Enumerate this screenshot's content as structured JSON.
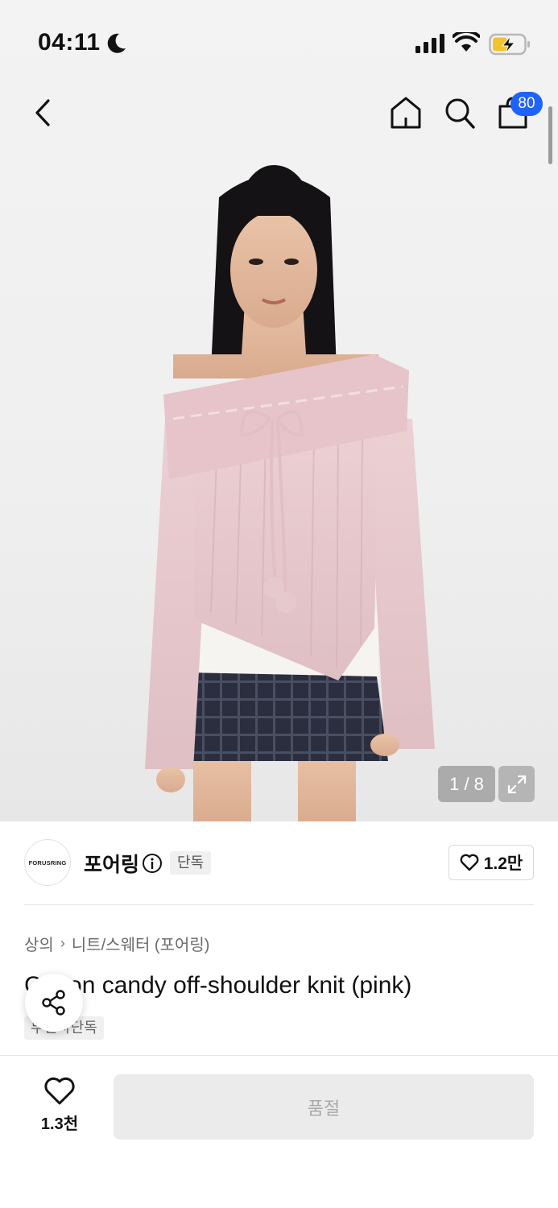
{
  "status_bar": {
    "time": "04:11",
    "icons": [
      "moon-icon",
      "signal-icon",
      "wifi-icon",
      "battery-charging-icon"
    ]
  },
  "nav": {
    "back_icon": "chevron-left-icon",
    "home_icon": "home-icon",
    "search_icon": "search-icon",
    "bag_icon": "shopping-bag-icon",
    "bag_count": "80"
  },
  "gallery": {
    "counter": "1 / 8",
    "expand_icon": "expand-icon"
  },
  "brand": {
    "logo_text": "FORUSRING",
    "name": "포어링",
    "info_icon": "info-icon",
    "tag": "단독",
    "like_count": "1.2만"
  },
  "product": {
    "breadcrumb": [
      "상의",
      "니트/스웨터 (포어링)"
    ],
    "title": "Cotton candy off-shoulder knit (pink)",
    "exclusive_tag": "무신사단독"
  },
  "bottom_bar": {
    "like_count": "1.3천",
    "soldout_label": "품절"
  },
  "colors": {
    "accent_blue": "#1e63ff",
    "sweater_pink": "#e8c9ce",
    "skirt_navy": "#2a2d3c"
  }
}
